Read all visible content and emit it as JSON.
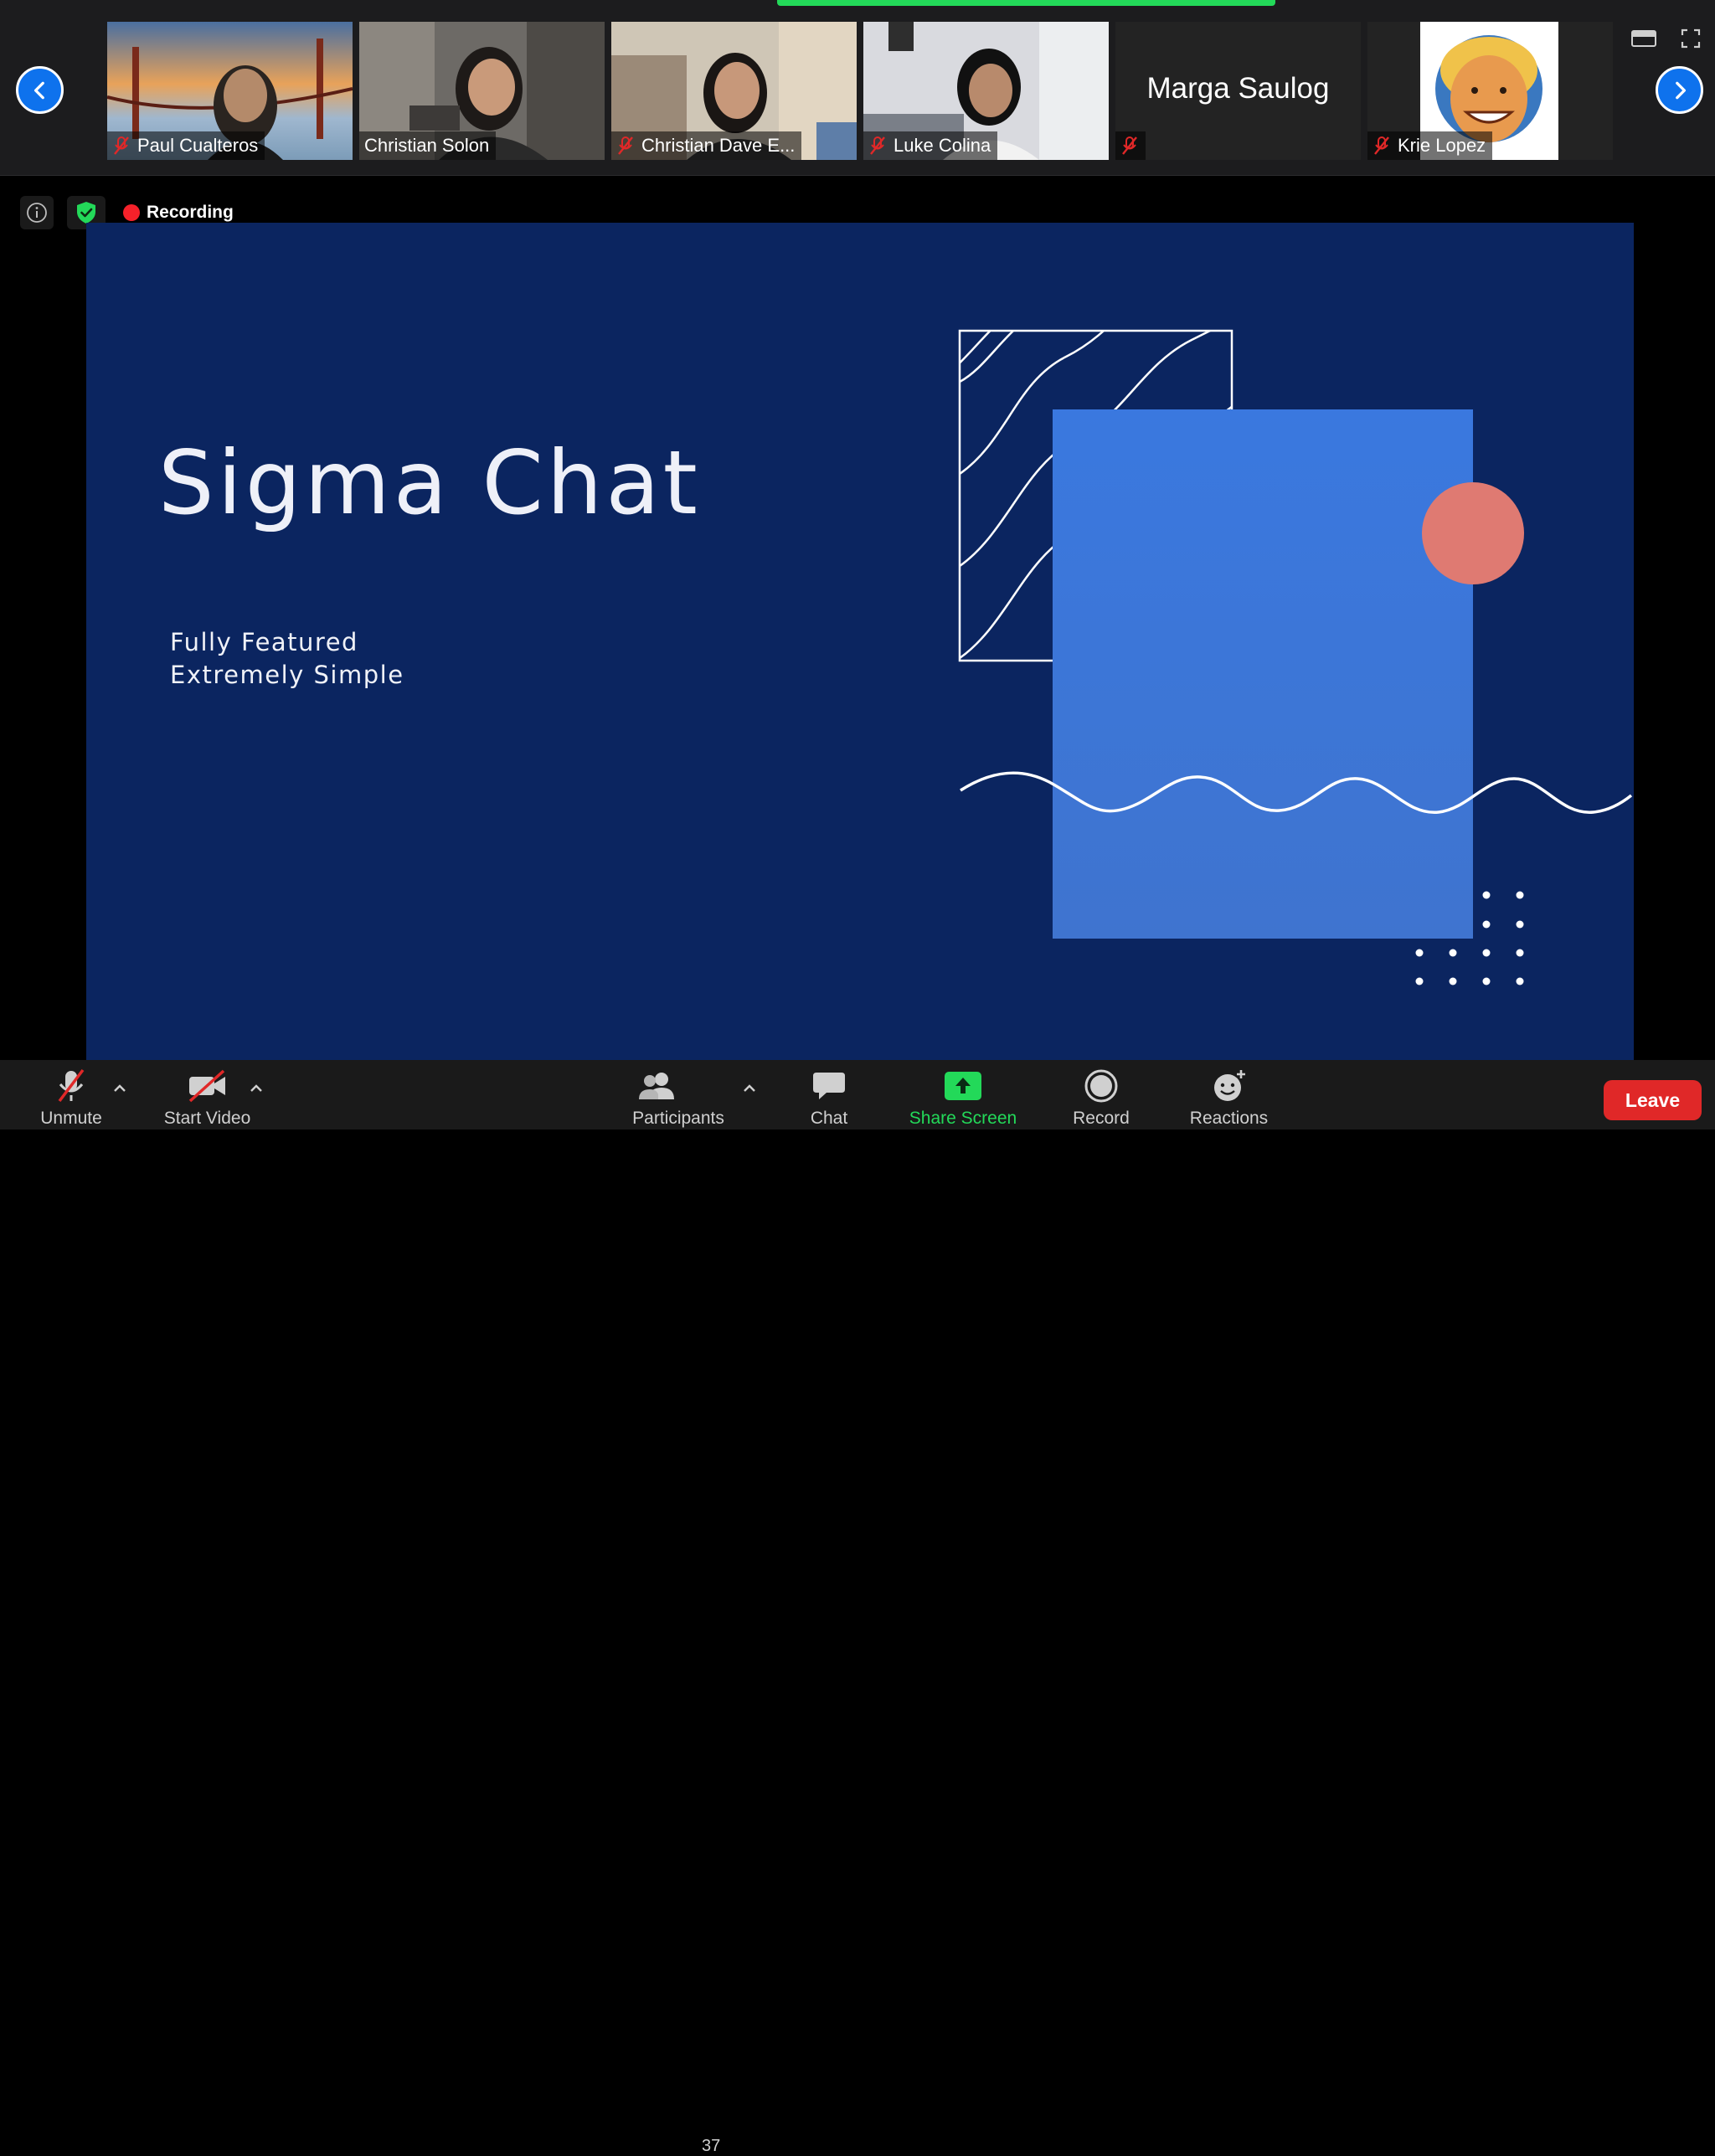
{
  "colors": {
    "accent": "#0e72ed",
    "active_speaker": "#23d959",
    "recording": "#f5212a",
    "leave": "#e02828",
    "slide_background": "#0b2560"
  },
  "gallery": {
    "tiles": [
      {
        "name": "Paul Cualteros",
        "muted": true,
        "video": true
      },
      {
        "name": "Christian Solon",
        "muted": false,
        "video": true
      },
      {
        "name": "Christian Dave E...",
        "muted": true,
        "video": true
      },
      {
        "name": "Luke Colina",
        "muted": true,
        "video": true
      },
      {
        "name": "Marga Saulog",
        "muted": true,
        "video": false
      },
      {
        "name": "Krie Lopez",
        "muted": true,
        "video": true
      }
    ]
  },
  "meeting": {
    "recording_label": "Recording"
  },
  "slide": {
    "title": "Sigma Chat",
    "subtitle_line1": "Fully Featured",
    "subtitle_line2": "Extremely Simple"
  },
  "toolbar": {
    "unmute": "Unmute",
    "start_video": "Start Video",
    "participants": "Participants",
    "participants_count": "37",
    "chat": "Chat",
    "share_screen": "Share Screen",
    "record": "Record",
    "reactions": "Reactions",
    "leave": "Leave"
  }
}
